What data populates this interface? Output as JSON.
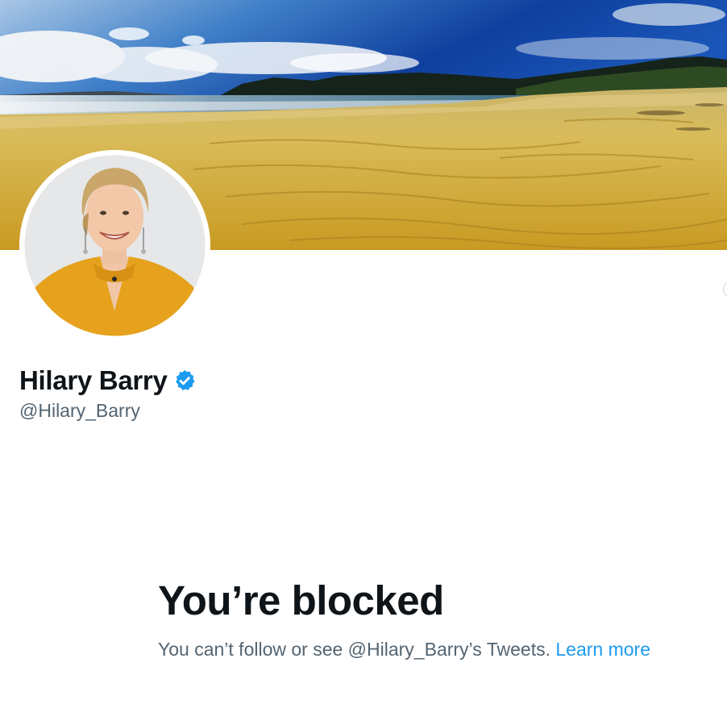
{
  "profile": {
    "display_name": "Hilary Barry",
    "handle": "@Hilary_Barry",
    "verified": true,
    "banner_icon": "beach-banner-image",
    "avatar_icon": "profile-photo"
  },
  "blocked": {
    "title": "You’re blocked",
    "message": "You can’t follow or see @Hilary_Barry’s Tweets. ",
    "link_label": "Learn more"
  },
  "colors": {
    "text_primary": "#0f1419",
    "text_secondary": "#536471",
    "link": "#1d9bf0",
    "verified_badge": "#1d9bf0"
  }
}
